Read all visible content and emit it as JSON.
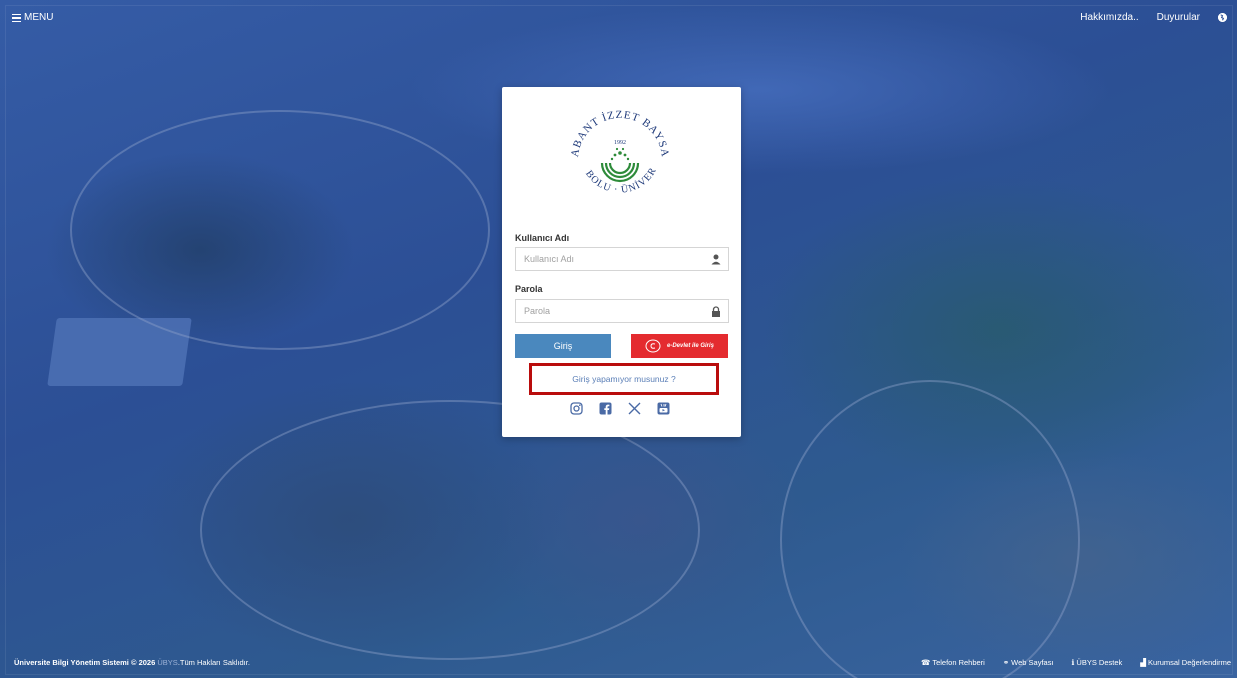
{
  "topbar": {
    "menu_label": "MENU",
    "about_label": "Hakkımızda..",
    "announcements_label": "Duyurular"
  },
  "logo": {
    "arc_text_top": "İZZET BAYSAL",
    "arc_left": "ABANT",
    "arc_right": "ÜNİVERSİTESİ",
    "arc_bottom": "BOLU",
    "year": "1992",
    "color": "#1f3a7a",
    "accent": "#2e8b3a"
  },
  "login": {
    "username_label": "Kullanıcı Adı",
    "username_placeholder": "Kullanıcı Adı",
    "password_label": "Parola",
    "password_placeholder": "Parola",
    "login_button": "Giriş",
    "edevlet_button": "e-Devlet ile Giriş",
    "forgot_link": "Giriş yapamıyor musunuz ?"
  },
  "social": [
    "instagram-icon",
    "facebook-icon",
    "x-icon",
    "youtube-icon"
  ],
  "footer": {
    "system_name": "Üniversite Bilgi Yönetim Sistemi © 2026",
    "ubys": "ÜBYS",
    "rights": ".Tüm Hakları Saklıdır.",
    "phone": "Telefon Rehberi",
    "web": "Web Sayfası",
    "support": "ÜBYS Destek",
    "evaluation": "Kurumsal Değerlendirme"
  },
  "colors": {
    "login_button": "#4a88be",
    "edevlet_button": "#e42b2f",
    "highlight_border": "#b90c0c",
    "background": "#2d4f97"
  }
}
